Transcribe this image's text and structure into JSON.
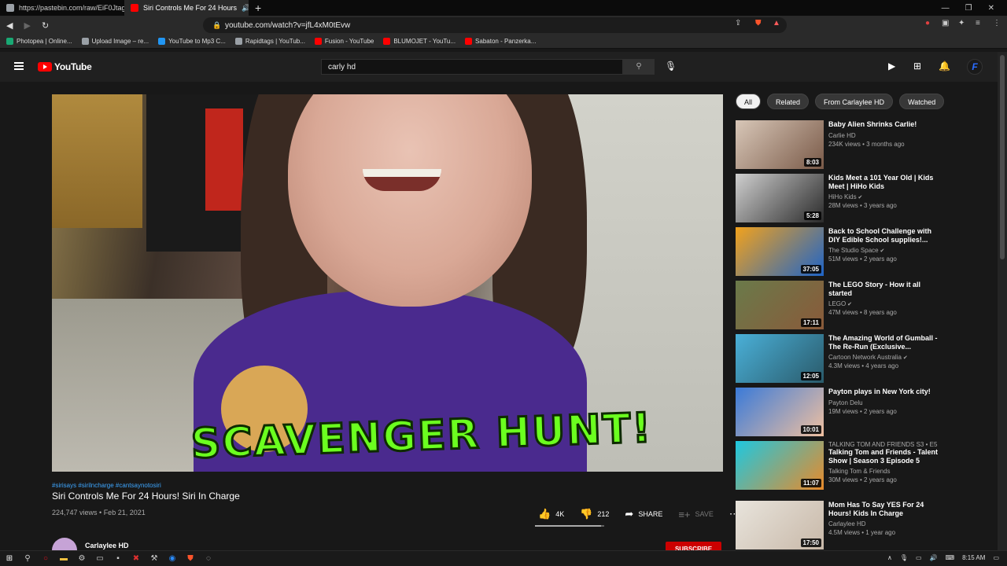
{
  "browser": {
    "tabs": [
      {
        "title": "https://pastebin.com/raw/EiF0Jtag",
        "favicon_color": "#9aa0a6",
        "active": false
      },
      {
        "title": "Siri Controls Me For 24 Hours",
        "favicon_color": "#ff0000",
        "active": true
      }
    ],
    "new_tab": "+",
    "url": "youtube.com/watch?v=jfL4xM0tEvw",
    "bookmarks": [
      {
        "label": "Photopea | Online...",
        "color": "#19a974"
      },
      {
        "label": "Upload Image – re...",
        "color": "#9aa0a6"
      },
      {
        "label": "YouTube to Mp3 C...",
        "color": "#2196f3"
      },
      {
        "label": "Rapidtags | YouTub...",
        "color": "#9aa0a6"
      },
      {
        "label": "Fusion - YouTube",
        "color": "#ff0000"
      },
      {
        "label": "BLUMOJET - YouTu...",
        "color": "#ff0000"
      },
      {
        "label": "Sabaton - Panzerka...",
        "color": "#ff0000"
      }
    ]
  },
  "youtube": {
    "logo_text": "YouTube",
    "search_value": "carly hd",
    "avatar_letter": "F"
  },
  "video": {
    "overlay_caption": "SCAVENGER HUNT!",
    "hashtags": "#sirisays #sirilncharge #cantsaynotosiri",
    "title": "Siri Controls Me For 24 Hours! Siri In Charge",
    "meta": "224,747 views • Feb 21, 2021",
    "likes": "4K",
    "dislikes": "212",
    "share": "SHARE",
    "save": "SAVE",
    "like_ratio": 0.95,
    "channel": "Carlaylee HD",
    "subscribe": "SUBSCRIBE"
  },
  "chips": [
    "All",
    "Related",
    "From Carlaylee HD",
    "Watched"
  ],
  "recommendations": [
    {
      "title": "Baby Alien Shrinks Carlie!",
      "channel": "Carlie HD",
      "meta": "234K views • 3 months ago",
      "duration": "8:03",
      "verified": false,
      "category": "",
      "thumb_colors": [
        "#d8c7b8",
        "#7a5a48"
      ]
    },
    {
      "title": "Kids Meet a 101 Year Old | Kids Meet | HiHo Kids",
      "channel": "HiHo Kids",
      "meta": "28M views • 3 years ago",
      "duration": "5:28",
      "verified": true,
      "category": "",
      "thumb_colors": [
        "#cfcfcf",
        "#2a2a2a"
      ]
    },
    {
      "title": "Back to School Challenge with DIY Edible School supplies!...",
      "channel": "The Studio Space",
      "meta": "51M views • 2 years ago",
      "duration": "37:05",
      "verified": true,
      "category": "",
      "thumb_colors": [
        "#f2a21c",
        "#1e64c8"
      ]
    },
    {
      "title": "The LEGO Story - How it all started",
      "channel": "LEGO",
      "meta": "47M views • 8 years ago",
      "duration": "17:11",
      "verified": true,
      "category": "",
      "thumb_colors": [
        "#6a7a4a",
        "#8a5a3a"
      ]
    },
    {
      "title": "The Amazing World of Gumball - The Re-Run (Exclusive...",
      "channel": "Cartoon Network Australia",
      "meta": "4.3M views • 4 years ago",
      "duration": "12:05",
      "verified": true,
      "category": "",
      "thumb_colors": [
        "#4ab0d8",
        "#2a5a6a"
      ]
    },
    {
      "title": "Payton plays in New York city!",
      "channel": "Payton Delu",
      "meta": "19M views • 2 years ago",
      "duration": "10:01",
      "verified": false,
      "category": "",
      "thumb_colors": [
        "#3a7ad8",
        "#f0c0a0"
      ]
    },
    {
      "title": "Talking Tom and Friends - Talent Show | Season 3 Episode 5",
      "channel": "Talking Tom & Friends",
      "meta": "30M views • 2 years ago",
      "duration": "11:07",
      "verified": false,
      "category": "TALKING TOM AND FRIENDS  S3 • E5",
      "thumb_colors": [
        "#1ec8e0",
        "#e88a2a"
      ]
    },
    {
      "title": "Mom Has To Say YES For 24 Hours! Kids In Charge",
      "channel": "Carlaylee HD",
      "meta": "4.5M views • 1 year ago",
      "duration": "17:50",
      "verified": false,
      "category": "",
      "thumb_colors": [
        "#e8e4dc",
        "#c8b8a8"
      ]
    }
  ],
  "taskbar": {
    "time": "8:15 AM"
  }
}
